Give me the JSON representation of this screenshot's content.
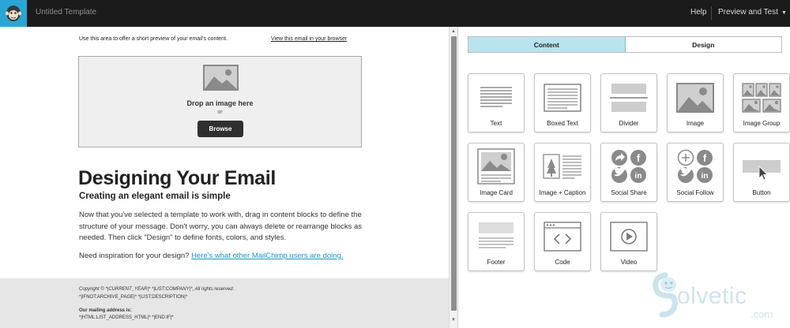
{
  "topbar": {
    "template_title": "Untitled Template",
    "help": "Help",
    "preview_test": "Preview and Test",
    "accent": "#2aa6d6"
  },
  "email": {
    "preheader_text": "Use this area to offer a short preview of your email's content.",
    "view_in_browser": "View this email in your browser",
    "dropzone": {
      "drop_label": "Drop an image here",
      "or_label": "or",
      "browse_label": "Browse"
    },
    "heading": "Designing Your Email",
    "subheading": "Creating an elegant email is simple",
    "body": "Now that you've selected a template to work with, drag in content blocks to define the structure of your message. Don't worry, you can always delete or rearrange blocks as needed. Then click \"Design\" to define fonts, colors, and styles.",
    "inspiration_prefix": "Need inspiration for your design?",
    "inspiration_link": "Here's what other MailChimp users are doing.",
    "footer": {
      "copyright": "Copyright © *|CURRENT_YEAR|* *|LIST:COMPANY|*, All rights reserved.",
      "archive": "*|IFNOT:ARCHIVE_PAGE|* *|LIST:DESCRIPTION|*",
      "mailing_label": "Our mailing address is:",
      "address": "*|HTML:LIST_ADDRESS_HTML|* *|END:IF|*"
    }
  },
  "panel": {
    "tabs": [
      "Content",
      "Design"
    ],
    "active_tab": "Content",
    "blocks": [
      {
        "label": "Text",
        "icon": "text-block-icon"
      },
      {
        "label": "Boxed Text",
        "icon": "boxed-text-block-icon"
      },
      {
        "label": "Divider",
        "icon": "divider-block-icon"
      },
      {
        "label": "Image",
        "icon": "image-block-icon"
      },
      {
        "label": "Image Group",
        "icon": "image-group-block-icon"
      },
      {
        "label": "Image Card",
        "icon": "image-card-block-icon"
      },
      {
        "label": "Image + Caption",
        "icon": "image-caption-block-icon"
      },
      {
        "label": "Social Share",
        "icon": "social-share-block-icon"
      },
      {
        "label": "Social Follow",
        "icon": "social-follow-block-icon"
      },
      {
        "label": "Button",
        "icon": "button-block-icon"
      },
      {
        "label": "Footer",
        "icon": "footer-block-icon"
      },
      {
        "label": "Code",
        "icon": "code-block-icon"
      },
      {
        "label": "Video",
        "icon": "video-block-icon"
      }
    ]
  },
  "watermark": {
    "brand": "olvetic",
    "domain": ".com"
  }
}
